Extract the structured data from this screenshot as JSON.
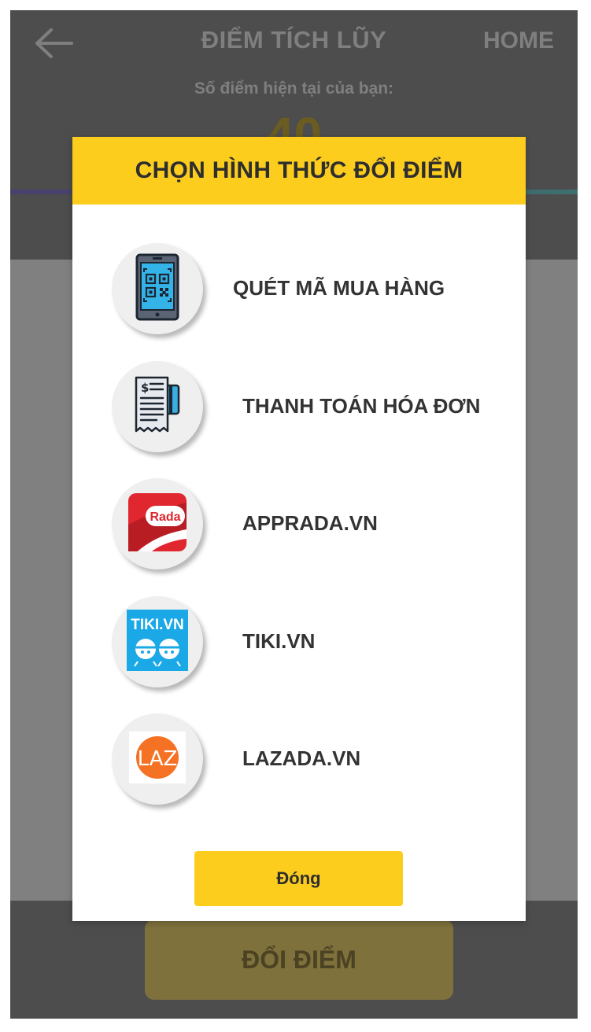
{
  "header": {
    "title": "ĐIỂM TÍCH LŨY",
    "home_label": "HOME",
    "points_label": "Số điểm hiện tại của bạn:",
    "points_value": "40"
  },
  "footer": {
    "redeem_label": "ĐỔI ĐIỂM"
  },
  "modal": {
    "title": "CHỌN HÌNH THỨC ĐỔI ĐIỂM",
    "options": [
      {
        "label": "QUÉT MÃ MUA HÀNG",
        "icon": "qr-phone-icon"
      },
      {
        "label": "THANH TOÁN HÓA ĐƠN",
        "icon": "bill-payment-icon"
      },
      {
        "label": "APPRADA.VN",
        "icon": "rada-logo-icon",
        "icon_text": "Rada"
      },
      {
        "label": "TIKI.VN",
        "icon": "tiki-logo-icon",
        "icon_text": "TIKI.VN"
      },
      {
        "label": "LAZADA.VN",
        "icon": "lazada-logo-icon",
        "icon_text": "LAZ"
      }
    ],
    "close_label": "Đóng"
  },
  "colors": {
    "accent_yellow": "#fdcd1e",
    "overlay_dark": "#4d4d4d",
    "overlay_body": "#808080",
    "rada_red": "#e0262f",
    "tiki_blue": "#1ba8e6",
    "lazada_orange": "#f57224"
  }
}
